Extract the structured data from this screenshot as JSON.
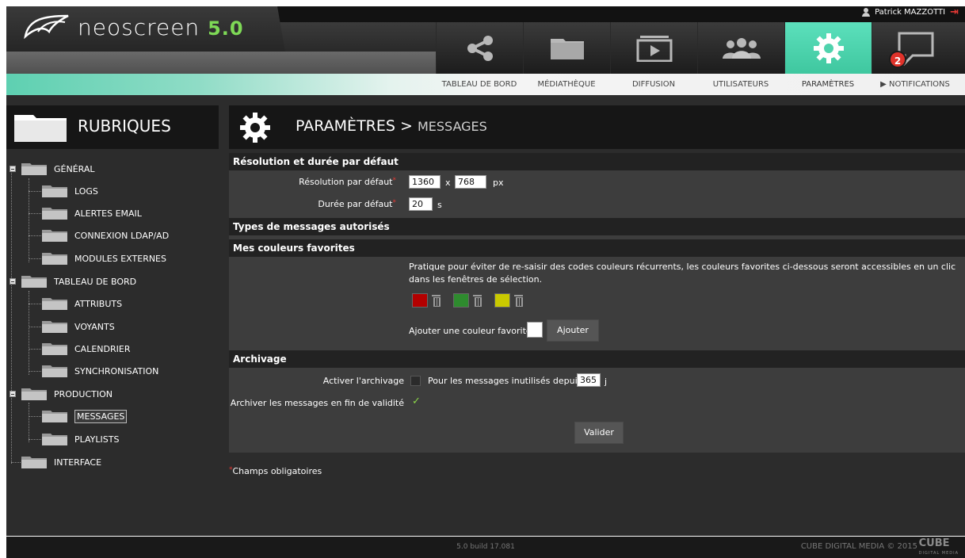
{
  "app": {
    "logo_text": "neoscreen",
    "logo_version": "5.0",
    "user_name": "Patrick MAZZOTTI"
  },
  "nav": {
    "items": [
      {
        "label": "TABLEAU DE BORD",
        "icon": "share-icon"
      },
      {
        "label": "MÉDIATHÈQUE",
        "icon": "folder-icon"
      },
      {
        "label": "DIFFUSION",
        "icon": "play-icon"
      },
      {
        "label": "UTILISATEURS",
        "icon": "users-icon"
      },
      {
        "label": "PARAMÈTRES",
        "icon": "gear-icon"
      },
      {
        "label": "▶ NOTIFICATIONS",
        "icon": "chat-icon"
      }
    ],
    "active": "PARAMÈTRES",
    "notification_count": "2"
  },
  "sidebar": {
    "title": "RUBRIQUES",
    "tree": [
      {
        "label": "GÉNÉRAL",
        "level": 0
      },
      {
        "label": "LOGS",
        "level": 1
      },
      {
        "label": "ALERTES EMAIL",
        "level": 1
      },
      {
        "label": "CONNEXION LDAP/AD",
        "level": 1
      },
      {
        "label": "MODULES EXTERNES",
        "level": 1
      },
      {
        "label": "TABLEAU DE BORD",
        "level": 0
      },
      {
        "label": "ATTRIBUTS",
        "level": 1
      },
      {
        "label": "VOYANTS",
        "level": 1
      },
      {
        "label": "CALENDRIER",
        "level": 1
      },
      {
        "label": "SYNCHRONISATION",
        "level": 1
      },
      {
        "label": "PRODUCTION",
        "level": 0
      },
      {
        "label": "MESSAGES",
        "level": 1,
        "selected": true
      },
      {
        "label": "PLAYLISTS",
        "level": 1
      },
      {
        "label": "INTERFACE",
        "level": 0
      }
    ]
  },
  "page": {
    "title": "PARAMÈTRES >",
    "subtitle": "MESSAGES"
  },
  "sections": {
    "resolution": {
      "title": "Résolution et durée par défaut",
      "res_label": "Résolution par défaut",
      "res_width": "1360",
      "res_x": "x",
      "res_height": "768",
      "res_unit": "px",
      "dur_label": "Durée par défaut",
      "dur_value": "20",
      "dur_unit": "s"
    },
    "types": {
      "title": "Types de messages autorisés"
    },
    "colors": {
      "title": "Mes couleurs favorites",
      "help": "Pratique pour éviter de re-saisir des codes couleurs récurrents, les couleurs favorites ci-dessous seront accessibles en un clic dans les fenêtres de sélection.",
      "swatches": [
        "#b30000",
        "#2e8b2e",
        "#c9c900"
      ],
      "add_label": "Ajouter une couleur favorite :",
      "add_button": "Ajouter"
    },
    "archive": {
      "title": "Archivage",
      "enable_label": "Activer l'archivage",
      "enable_checked": false,
      "unused_label": "Pour les messages inutilisés depuis",
      "unused_days": "365",
      "unused_unit": "j",
      "expire_label": "Archiver les messages en fin de validité",
      "expire_checked": true,
      "submit": "Valider"
    }
  },
  "footnote": "Champs obligatoires",
  "footer": {
    "build": "5.0 build 17.081",
    "copyright": "CUBE DIGITAL MEDIA © 2015",
    "brand": "CUBE",
    "brand_sub": "DIGITAL MEDIA"
  }
}
